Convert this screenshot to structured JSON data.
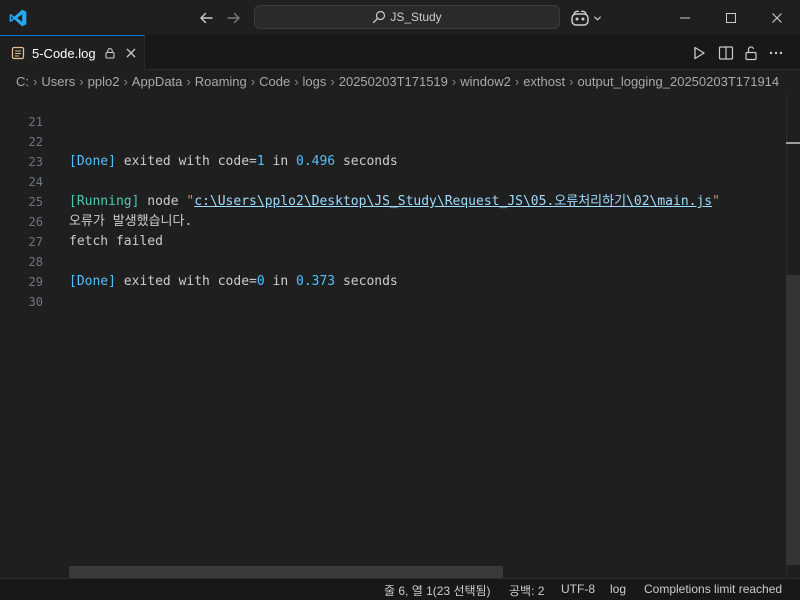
{
  "window": {
    "command_center_label": "JS_Study"
  },
  "tab": {
    "label": "5-Code.log"
  },
  "breadcrumb": [
    "C:",
    "Users",
    "pplo2",
    "AppData",
    "Roaming",
    "Code",
    "logs",
    "20250203T171519",
    "window2",
    "exthost",
    "output_logging_20250203T171914"
  ],
  "editor": {
    "lines": [
      {
        "num": "21"
      },
      {
        "num": "22",
        "done_tag": "[Done]",
        "text_a": " exited with code=",
        "code_val": "1",
        "text_b": " in ",
        "time_val": "0.496",
        "text_c": " seconds"
      },
      {
        "num": "23"
      },
      {
        "num": "24",
        "running_tag": "[Running]",
        "text_a": " node ",
        "quote_open": "\"",
        "path": "c:\\Users\\pplo2\\Desktop\\JS_Study\\Request_JS\\05.오류처리하기\\02\\main.js",
        "quote_close": "\""
      },
      {
        "num": "25",
        "text": "오류가 발생했습니다."
      },
      {
        "num": "26",
        "text": "fetch failed"
      },
      {
        "num": "27"
      },
      {
        "num": "28",
        "done_tag": "[Done]",
        "text_a": " exited with code=",
        "code_val": "0",
        "text_b": " in ",
        "time_val": "0.373",
        "text_c": " seconds"
      },
      {
        "num": "29"
      },
      {
        "num": "30"
      }
    ]
  },
  "statusbar": {
    "cursor": "줄 6, 열 1(23 선택됨)",
    "indent": "공백: 2",
    "encoding": "UTF-8",
    "language": "log",
    "completions": "Completions limit reached"
  },
  "colors": {
    "accent": "#0078d4",
    "vscode_blue": "#23a9f2"
  }
}
